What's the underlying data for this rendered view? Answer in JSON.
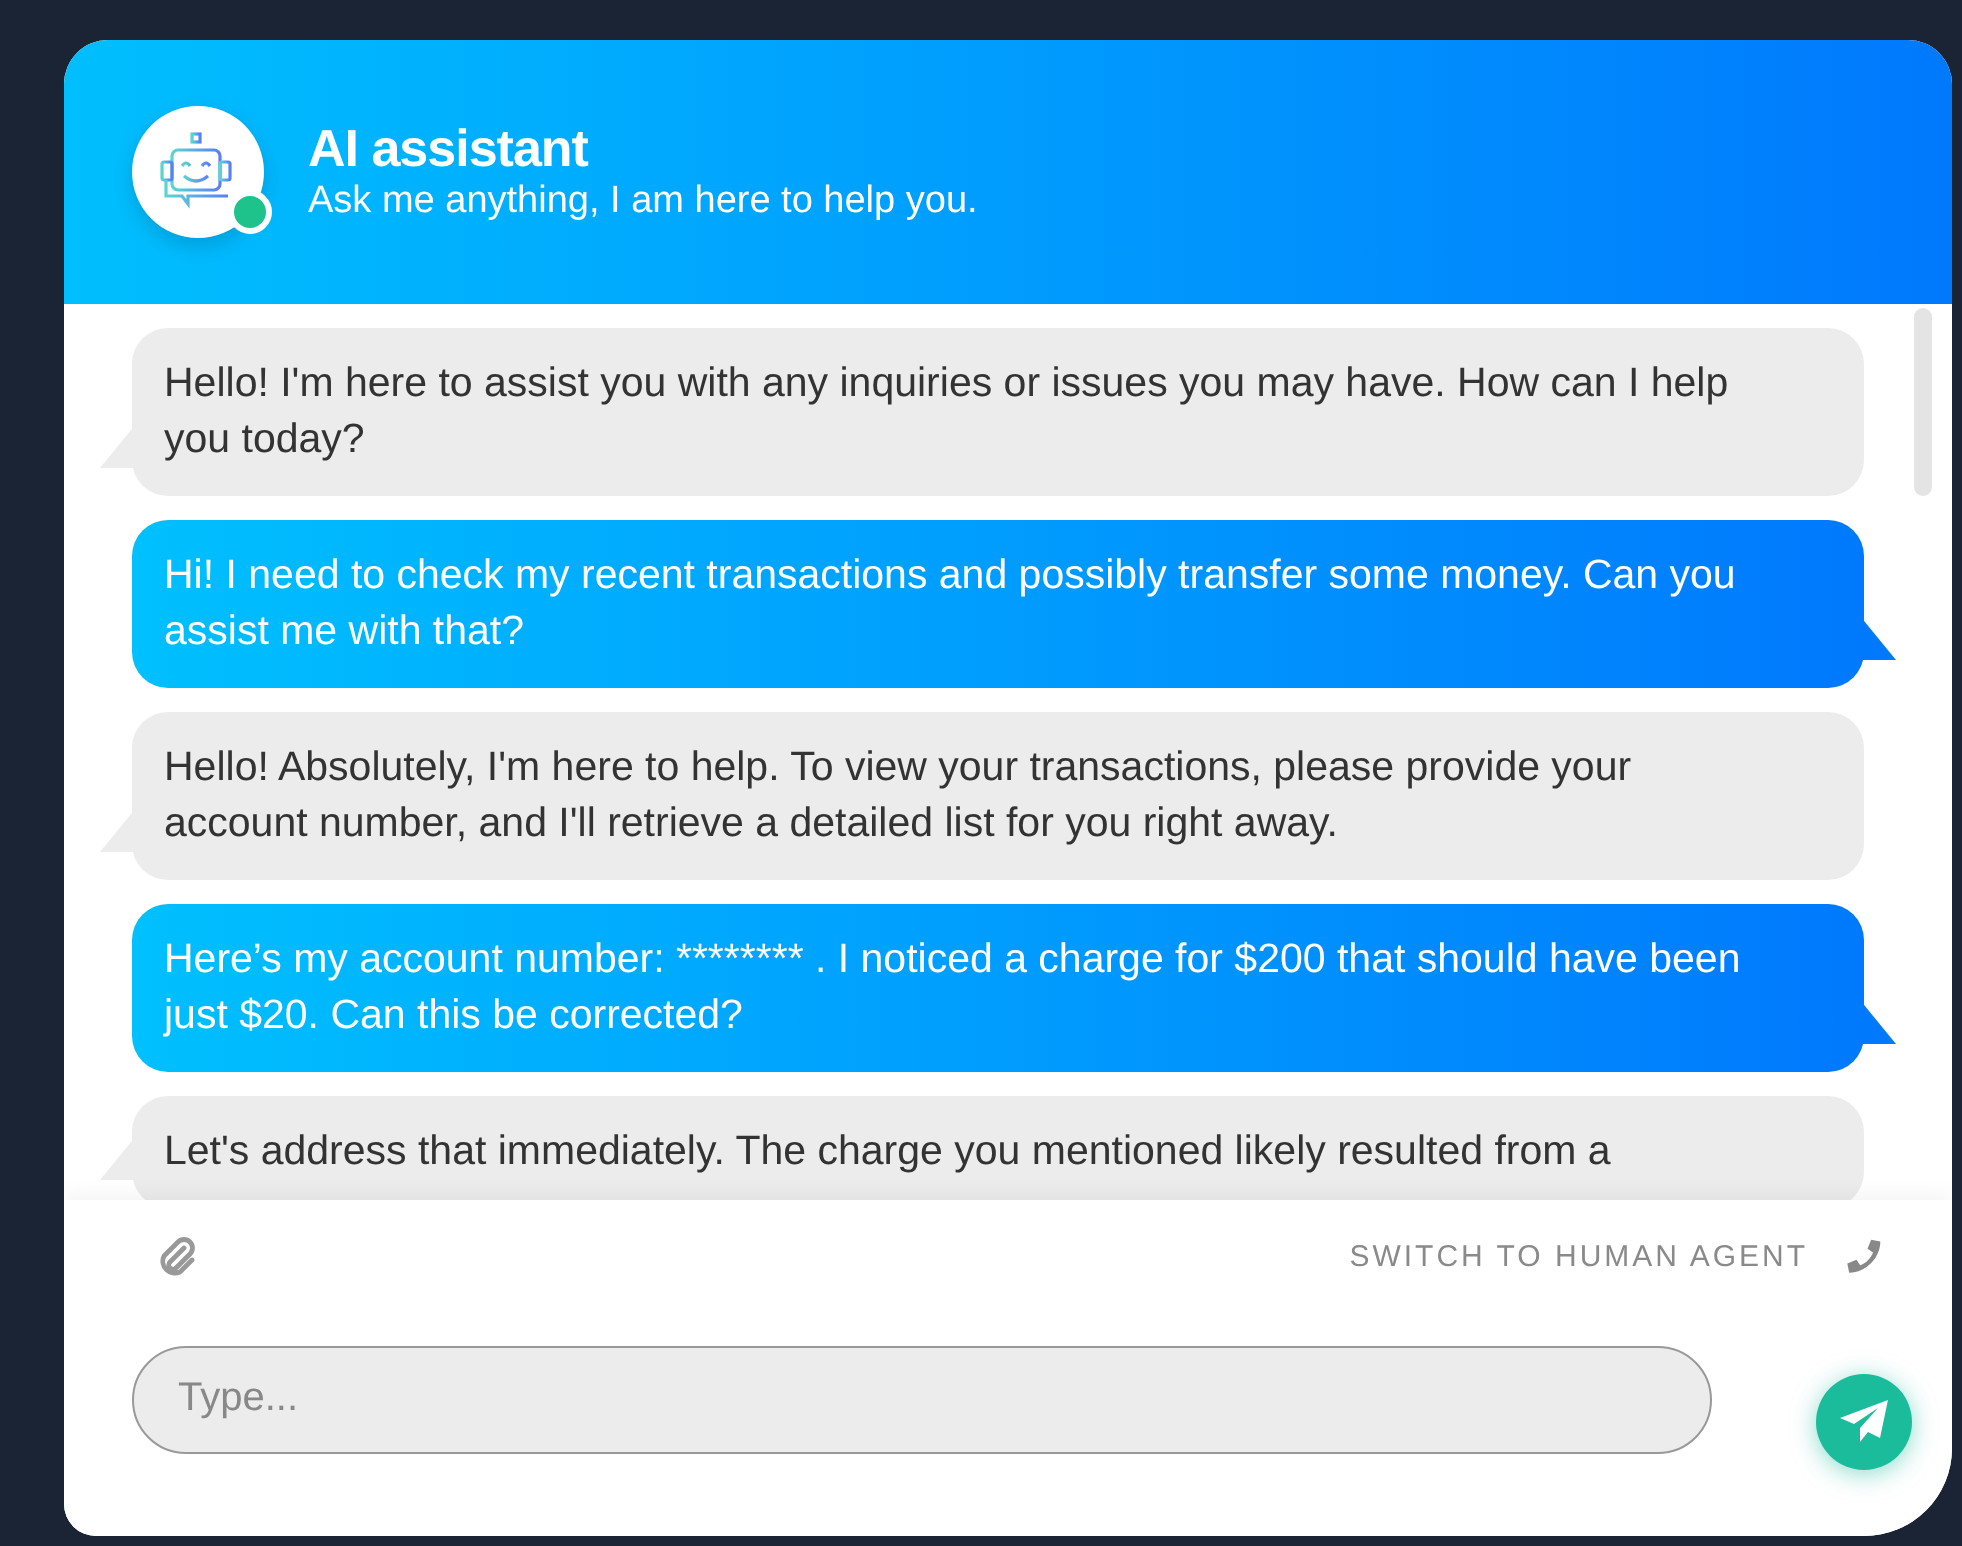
{
  "header": {
    "title": "AI assistant",
    "subtitle": "Ask me anything, I am here to help you.",
    "online": true
  },
  "messages": [
    {
      "kind": "bot",
      "text": "Hello! I'm here to assist you with any inquiries or issues you may have. How can I help you today?"
    },
    {
      "kind": "user",
      "text": "Hi! I need to check my recent transactions and possibly transfer some money. Can you assist me with that?"
    },
    {
      "kind": "bot",
      "text": "Hello! Absolutely, I'm here to help. To view your transactions, please provide your account number, and I'll retrieve a detailed list for you right away."
    },
    {
      "kind": "user",
      "text": "Here’s my account number: ******** . I noticed a charge for $200 that should have been just $20. Can this be corrected?"
    },
    {
      "kind": "bot",
      "text": "Let's address that immediately. The charge you mentioned likely resulted from a"
    }
  ],
  "footer": {
    "switch_label": "SWITCH TO HUMAN AGENT",
    "input": {
      "placeholder": "Type..."
    }
  }
}
